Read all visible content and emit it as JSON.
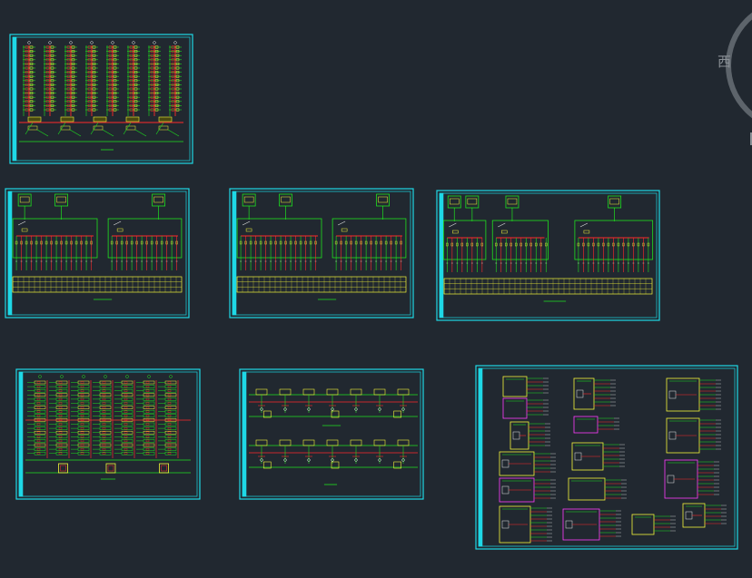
{
  "app": {
    "background": "#212830"
  },
  "viewcube": {
    "label": "西",
    "ring_color": "#5d646b"
  },
  "colors": {
    "border": "#1ed8e6",
    "inner": "#19c2cf",
    "green": "#1fe01f",
    "red": "#ff2a2a",
    "yellow": "#f4f43a",
    "magenta": "#ff3cff",
    "white": "#e6e6e6"
  },
  "sheets": [
    {
      "name": "sheet-riser-diagram",
      "kind": "riser"
    },
    {
      "name": "sheet-distribution-1",
      "kind": "panel",
      "boxes": 2
    },
    {
      "name": "sheet-distribution-2",
      "kind": "panel",
      "boxes": 2
    },
    {
      "name": "sheet-distribution-3",
      "kind": "panel",
      "boxes": 3
    },
    {
      "name": "sheet-meter-box-riser",
      "kind": "meters"
    },
    {
      "name": "sheet-circuit-diagram",
      "kind": "circuits"
    },
    {
      "name": "sheet-panel-schedules",
      "kind": "schedules"
    }
  ]
}
